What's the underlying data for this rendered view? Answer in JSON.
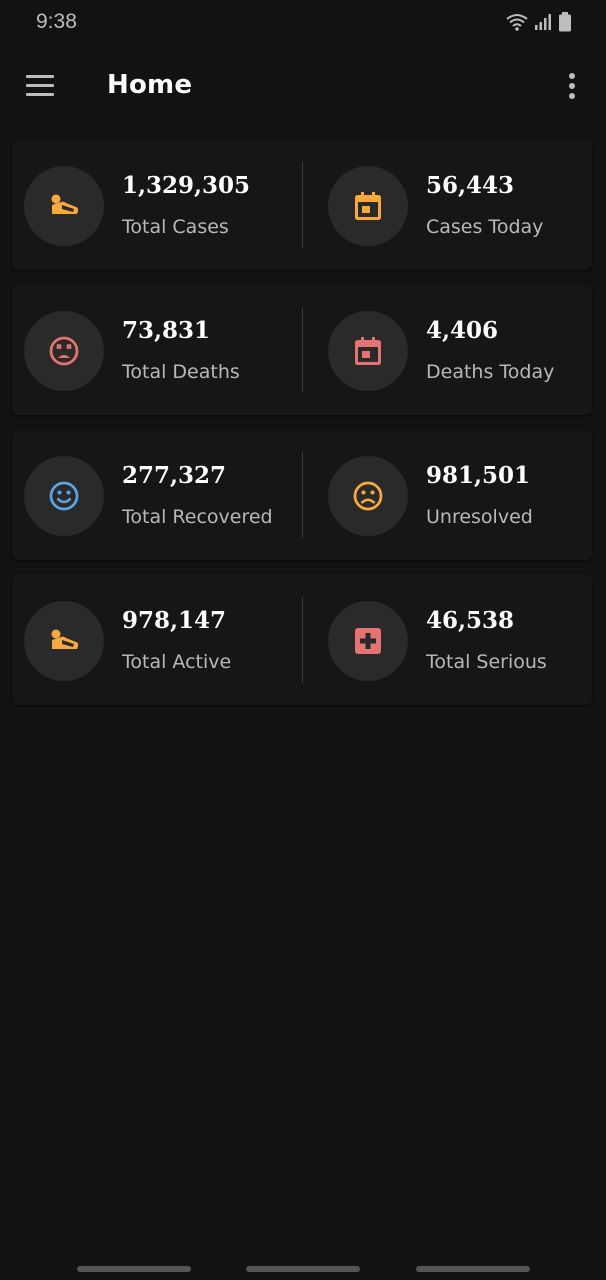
{
  "status_bar": {
    "time": "9:38"
  },
  "app_bar": {
    "title": "Home",
    "menu_icon": "hamburger-menu-icon",
    "more_icon": "more-vertical-icon"
  },
  "colors": {
    "orange": "#f7a93b",
    "red": "#e57373",
    "blue": "#5ba4e5",
    "background": "#121212",
    "card": "#161616",
    "circle": "#2a2a2a"
  },
  "stats": [
    [
      {
        "value": "1,329,305",
        "label": "Total Cases",
        "icon": "sick-person-icon",
        "color": "orange"
      },
      {
        "value": "56,443",
        "label": "Cases Today",
        "icon": "calendar-icon",
        "color": "orange"
      }
    ],
    [
      {
        "value": "73,831",
        "label": "Total Deaths",
        "icon": "dead-face-icon",
        "color": "red"
      },
      {
        "value": "4,406",
        "label": "Deaths Today",
        "icon": "calendar-icon",
        "color": "red"
      }
    ],
    [
      {
        "value": "277,327",
        "label": "Total Recovered",
        "icon": "happy-face-icon",
        "color": "blue"
      },
      {
        "value": "981,501",
        "label": "Unresolved",
        "icon": "sad-face-icon",
        "color": "orange"
      }
    ],
    [
      {
        "value": "978,147",
        "label": "Total Active",
        "icon": "sick-person-icon",
        "color": "orange"
      },
      {
        "value": "46,538",
        "label": "Total Serious",
        "icon": "medical-cross-icon",
        "color": "red"
      }
    ]
  ]
}
